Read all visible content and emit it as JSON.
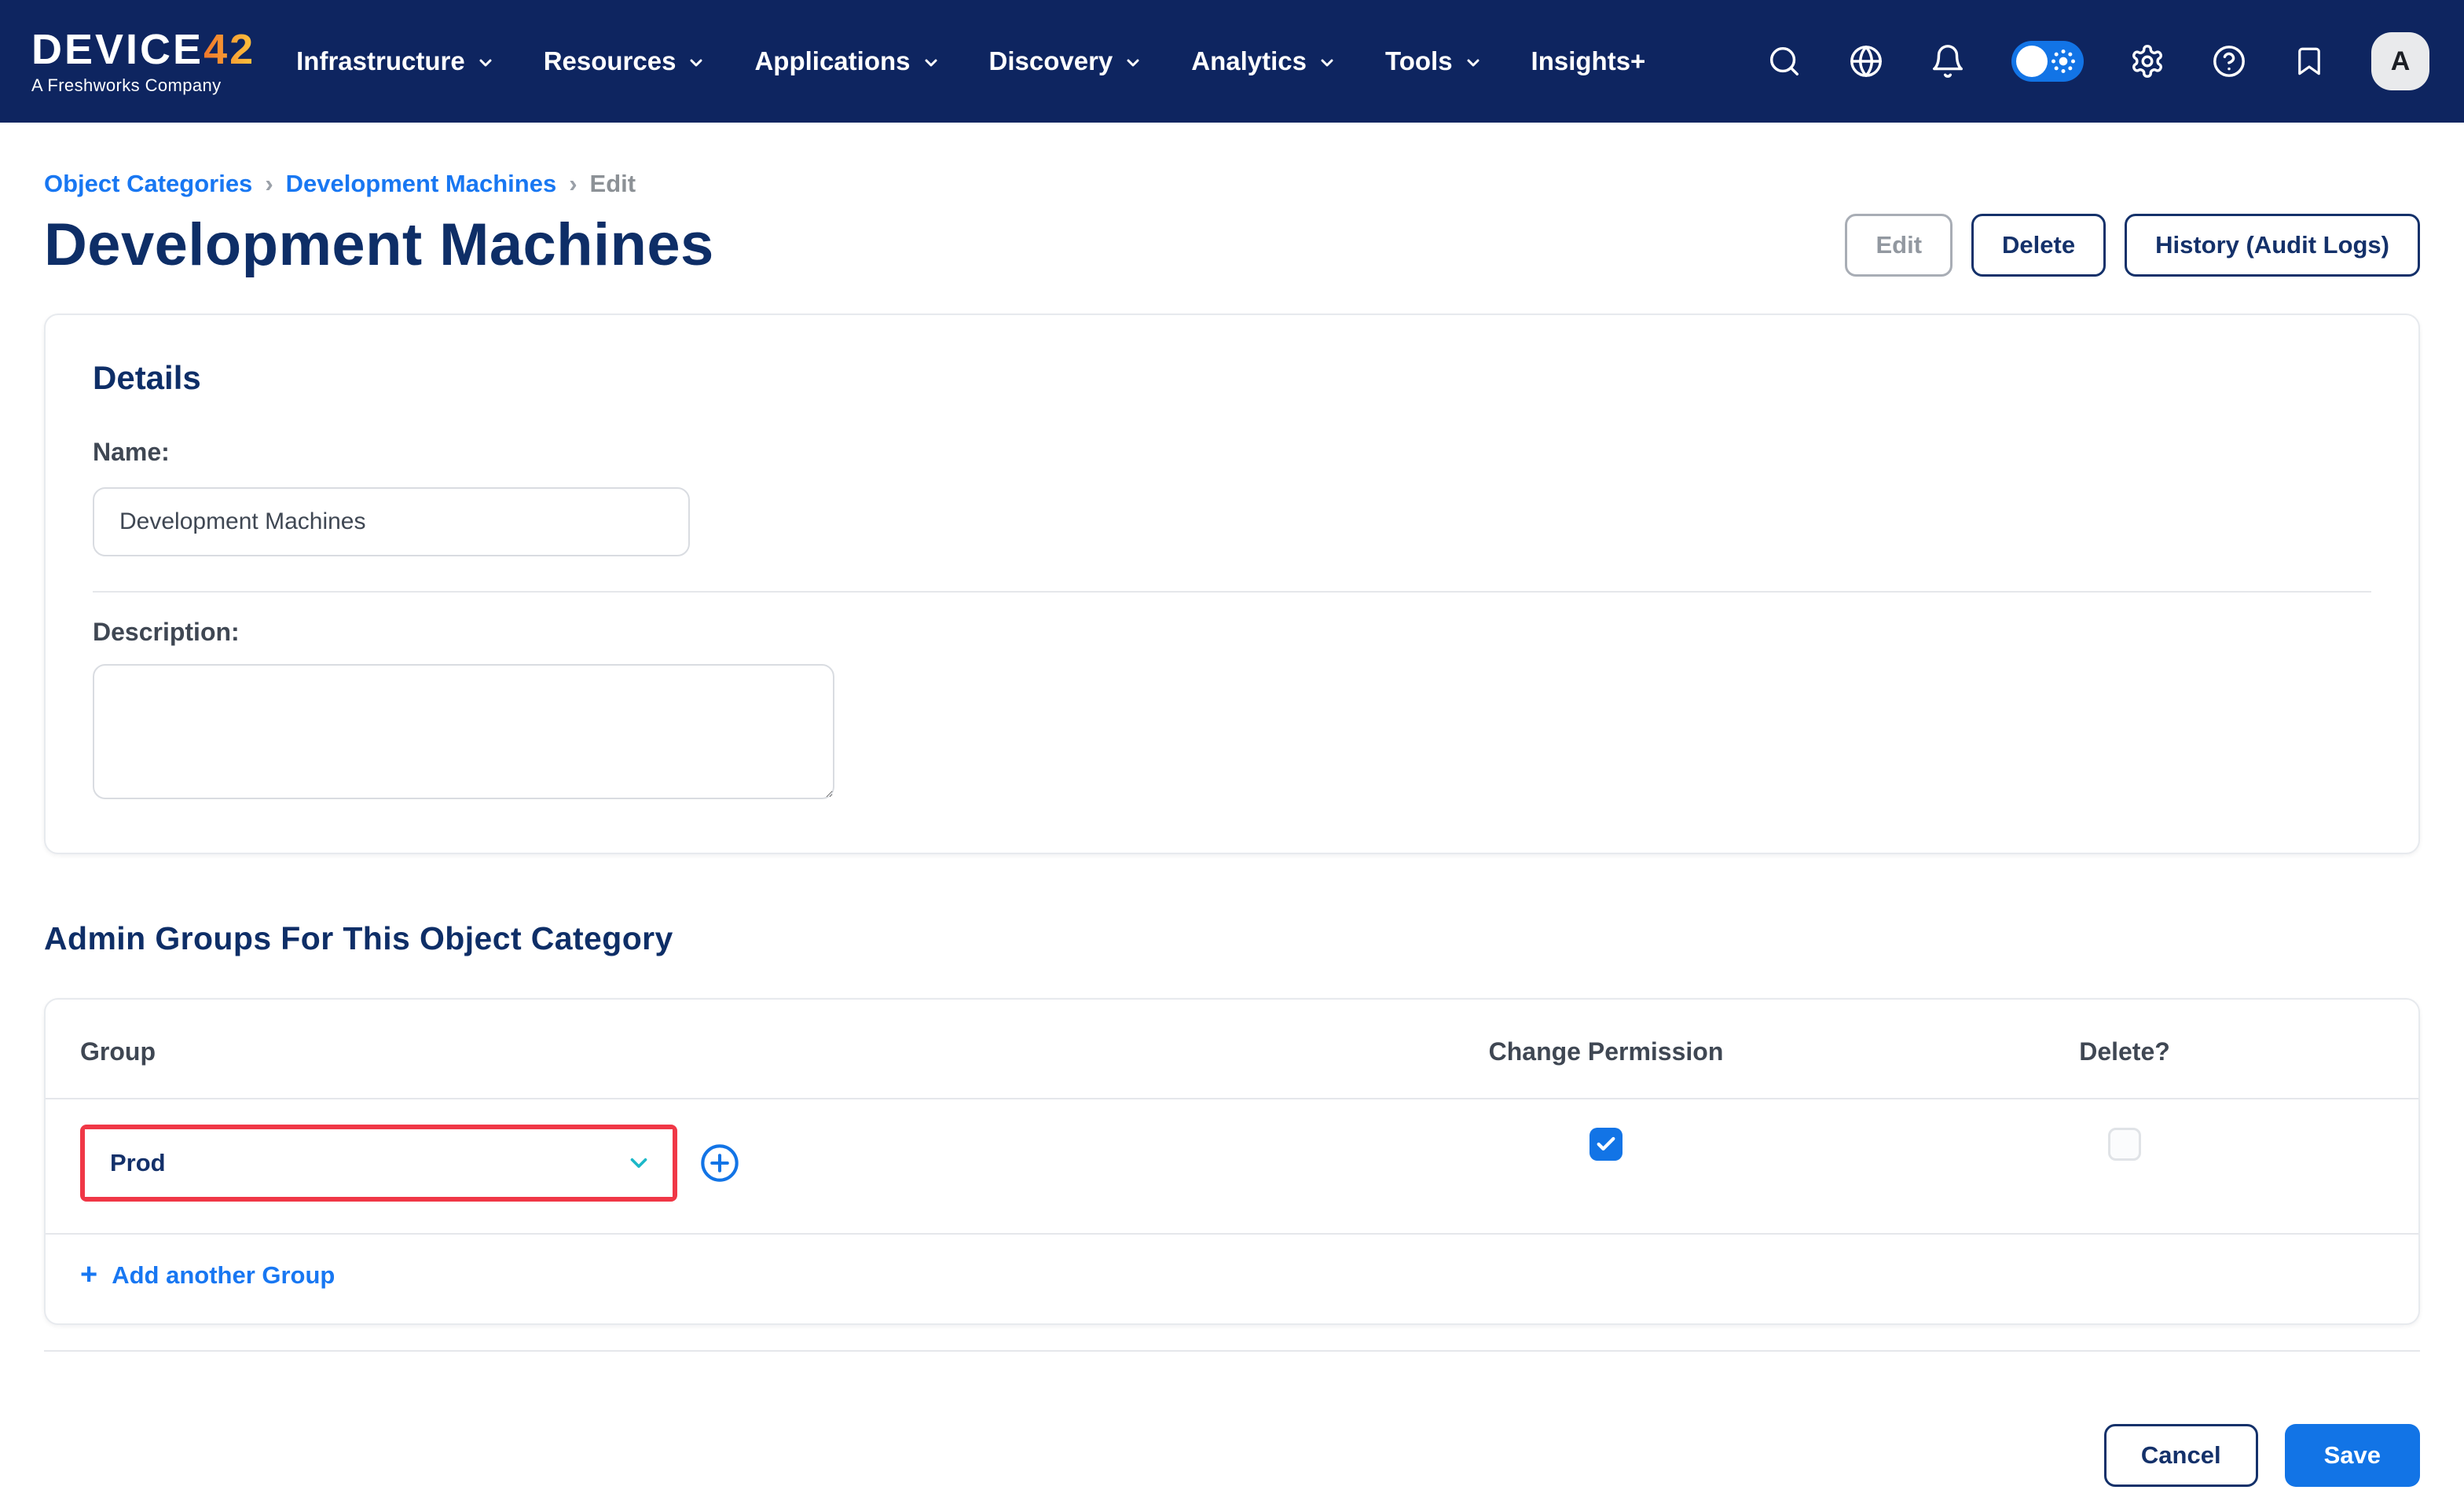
{
  "nav": {
    "logo": {
      "brand": "DEVICE",
      "brand_accent": "42",
      "tagline": "A Freshworks Company"
    },
    "items": [
      {
        "label": "Infrastructure",
        "has_dropdown": true
      },
      {
        "label": "Resources",
        "has_dropdown": true
      },
      {
        "label": "Applications",
        "has_dropdown": true
      },
      {
        "label": "Discovery",
        "has_dropdown": true
      },
      {
        "label": "Analytics",
        "has_dropdown": true
      },
      {
        "label": "Tools",
        "has_dropdown": true
      },
      {
        "label": "Insights+",
        "has_dropdown": false
      }
    ],
    "right_icons": [
      "search",
      "language-globe",
      "notifications-bell",
      "theme-toggle",
      "settings-gear",
      "help",
      "bookmark"
    ],
    "theme_toggle_on": true,
    "avatar_initial": "A"
  },
  "breadcrumb": {
    "separator": "›",
    "items": [
      {
        "label": "Object Categories",
        "type": "link"
      },
      {
        "label": "Development Machines",
        "type": "link"
      },
      {
        "label": "Edit",
        "type": "current"
      }
    ]
  },
  "page": {
    "title": "Development Machines",
    "actions": [
      {
        "label": "Edit",
        "disabled": true
      },
      {
        "label": "Delete",
        "disabled": false
      },
      {
        "label": "History (Audit Logs)",
        "disabled": false
      }
    ]
  },
  "details": {
    "heading": "Details",
    "name_label": "Name:",
    "name_value": "Development Machines",
    "description_label": "Description:",
    "description_value": ""
  },
  "admin_groups": {
    "heading": "Admin Groups For This Object Category",
    "columns": [
      "Group",
      "Change Permission",
      "Delete?"
    ],
    "rows": [
      {
        "group": "Prod",
        "change_permission": true,
        "delete": false,
        "highlighted": true
      }
    ],
    "add_plus_glyph": "+",
    "add_label": "Add another Group"
  },
  "footer": {
    "cancel_label": "Cancel",
    "save_label": "Save"
  },
  "colors": {
    "nav_bg": "#0E2560",
    "accent": "#1274E6",
    "link_blue": "#1877F2",
    "navy": "#0E2E67",
    "highlight_red": "#F03746",
    "teal_chevron": "#1CB8C8",
    "logo_accent_orange": "#F7A023"
  }
}
